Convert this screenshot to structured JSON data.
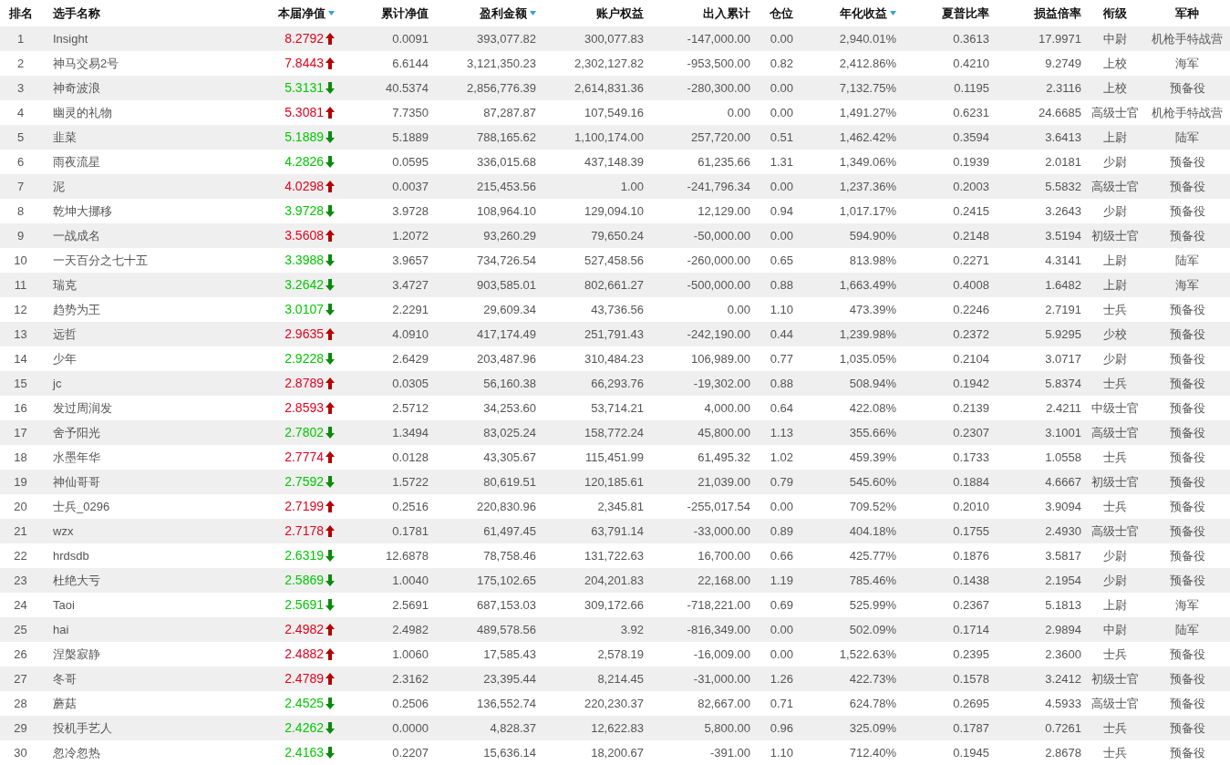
{
  "table": {
    "columns": [
      {
        "label": "排名",
        "sort_indicator": false
      },
      {
        "label": "选手名称",
        "sort_indicator": false
      },
      {
        "label": "本届净值",
        "sort_indicator": true
      },
      {
        "label": "累计净值",
        "sort_indicator": false
      },
      {
        "label": "盈利金额",
        "sort_indicator": true
      },
      {
        "label": "账户权益",
        "sort_indicator": false
      },
      {
        "label": "出入累计",
        "sort_indicator": false
      },
      {
        "label": "仓位",
        "sort_indicator": false
      },
      {
        "label": "年化收益",
        "sort_indicator": true
      },
      {
        "label": "夏普比率",
        "sort_indicator": false
      },
      {
        "label": "损益倍率",
        "sort_indicator": false
      },
      {
        "label": "衔级",
        "sort_indicator": false
      },
      {
        "label": "军种",
        "sort_indicator": false
      }
    ],
    "rows": [
      {
        "rising": true,
        "cells": [
          "1",
          "Insight",
          "8.2792",
          "0.0091",
          "393,077.82",
          "300,077.83",
          "-147,000.00",
          "0.00",
          "2,940.01%",
          "0.3613",
          "17.9971",
          "中尉",
          "机枪手特战营"
        ]
      },
      {
        "rising": true,
        "cells": [
          "2",
          "神马交易2号",
          "7.8443",
          "6.6144",
          "3,121,350.23",
          "2,302,127.82",
          "-953,500.00",
          "0.82",
          "2,412.86%",
          "0.4210",
          "9.2749",
          "上校",
          "海军"
        ]
      },
      {
        "rising": false,
        "cells": [
          "3",
          "神奇波浪",
          "5.3131",
          "40.5374",
          "2,856,776.39",
          "2,614,831.36",
          "-280,300.00",
          "0.00",
          "7,132.75%",
          "0.1195",
          "2.3116",
          "上校",
          "预备役"
        ]
      },
      {
        "rising": true,
        "cells": [
          "4",
          "幽灵的礼物",
          "5.3081",
          "7.7350",
          "87,287.87",
          "107,549.16",
          "0.00",
          "0.00",
          "1,491.27%",
          "0.6231",
          "24.6685",
          "高级士官",
          "机枪手特战营"
        ]
      },
      {
        "rising": false,
        "cells": [
          "5",
          "韭菜",
          "5.1889",
          "5.1889",
          "788,165.62",
          "1,100,174.00",
          "257,720.00",
          "0.51",
          "1,462.42%",
          "0.3594",
          "3.6413",
          "上尉",
          "陆军"
        ]
      },
      {
        "rising": false,
        "cells": [
          "6",
          "雨夜流星",
          "4.2826",
          "0.0595",
          "336,015.68",
          "437,148.39",
          "61,235.66",
          "1.31",
          "1,349.06%",
          "0.1939",
          "2.0181",
          "少尉",
          "预备役"
        ]
      },
      {
        "rising": true,
        "cells": [
          "7",
          "泥",
          "4.0298",
          "0.0037",
          "215,453.56",
          "1.00",
          "-241,796.34",
          "0.00",
          "1,237.36%",
          "0.2003",
          "5.5832",
          "高级士官",
          "预备役"
        ]
      },
      {
        "rising": false,
        "cells": [
          "8",
          "乾坤大挪移",
          "3.9728",
          "3.9728",
          "108,964.10",
          "129,094.10",
          "12,129.00",
          "0.94",
          "1,017.17%",
          "0.2415",
          "3.2643",
          "少尉",
          "预备役"
        ]
      },
      {
        "rising": true,
        "cells": [
          "9",
          "一战成名",
          "3.5608",
          "1.2072",
          "93,260.29",
          "79,650.24",
          "-50,000.00",
          "0.00",
          "594.90%",
          "0.2148",
          "3.5194",
          "初级士官",
          "预备役"
        ]
      },
      {
        "rising": false,
        "cells": [
          "10",
          "一天百分之七十五",
          "3.3988",
          "3.9657",
          "734,726.54",
          "527,458.56",
          "-260,000.00",
          "0.65",
          "813.98%",
          "0.2271",
          "4.3141",
          "上尉",
          "陆军"
        ]
      },
      {
        "rising": false,
        "cells": [
          "11",
          "瑞克",
          "3.2642",
          "3.4727",
          "903,585.01",
          "802,661.27",
          "-500,000.00",
          "0.88",
          "1,663.49%",
          "0.4008",
          "1.6482",
          "上尉",
          "海军"
        ]
      },
      {
        "rising": false,
        "cells": [
          "12",
          "趋势为王",
          "3.0107",
          "2.2291",
          "29,609.34",
          "43,736.56",
          "0.00",
          "1.10",
          "473.39%",
          "0.2246",
          "2.7191",
          "士兵",
          "预备役"
        ]
      },
      {
        "rising": true,
        "cells": [
          "13",
          "远哲",
          "2.9635",
          "4.0910",
          "417,174.49",
          "251,791.43",
          "-242,190.00",
          "0.44",
          "1,239.98%",
          "0.2372",
          "5.9295",
          "少校",
          "预备役"
        ]
      },
      {
        "rising": false,
        "cells": [
          "14",
          "少年",
          "2.9228",
          "2.6429",
          "203,487.96",
          "310,484.23",
          "106,989.00",
          "0.77",
          "1,035.05%",
          "0.2104",
          "3.0717",
          "少尉",
          "预备役"
        ]
      },
      {
        "rising": true,
        "cells": [
          "15",
          "jc",
          "2.8789",
          "0.0305",
          "56,160.38",
          "66,293.76",
          "-19,302.00",
          "0.88",
          "508.94%",
          "0.1942",
          "5.8374",
          "士兵",
          "预备役"
        ]
      },
      {
        "rising": true,
        "cells": [
          "16",
          "发过周润发",
          "2.8593",
          "2.5712",
          "34,253.60",
          "53,714.21",
          "4,000.00",
          "0.64",
          "422.08%",
          "0.2139",
          "2.4211",
          "中级士官",
          "预备役"
        ]
      },
      {
        "rising": false,
        "cells": [
          "17",
          "舍予阳光",
          "2.7802",
          "1.3494",
          "83,025.24",
          "158,772.24",
          "45,800.00",
          "1.13",
          "355.66%",
          "0.2307",
          "3.1001",
          "高级士官",
          "预备役"
        ]
      },
      {
        "rising": true,
        "cells": [
          "18",
          "水墨年华",
          "2.7774",
          "0.0128",
          "43,305.67",
          "115,451.99",
          "61,495.32",
          "1.02",
          "459.39%",
          "0.1733",
          "1.0558",
          "士兵",
          "预备役"
        ]
      },
      {
        "rising": false,
        "cells": [
          "19",
          "神仙哥哥",
          "2.7592",
          "1.5722",
          "80,619.51",
          "120,185.61",
          "21,039.00",
          "0.79",
          "545.60%",
          "0.1884",
          "4.6667",
          "初级士官",
          "预备役"
        ]
      },
      {
        "rising": true,
        "cells": [
          "20",
          "士兵_0296",
          "2.7199",
          "0.2516",
          "220,830.96",
          "2,345.81",
          "-255,017.54",
          "0.00",
          "709.52%",
          "0.2010",
          "3.9094",
          "士兵",
          "预备役"
        ]
      },
      {
        "rising": true,
        "cells": [
          "21",
          "wzx",
          "2.7178",
          "0.1781",
          "61,497.45",
          "63,791.14",
          "-33,000.00",
          "0.89",
          "404.18%",
          "0.1755",
          "2.4930",
          "高级士官",
          "预备役"
        ]
      },
      {
        "rising": false,
        "cells": [
          "22",
          "hrdsdb",
          "2.6319",
          "12.6878",
          "78,758.46",
          "131,722.63",
          "16,700.00",
          "0.66",
          "425.77%",
          "0.1876",
          "3.5817",
          "少尉",
          "预备役"
        ]
      },
      {
        "rising": false,
        "cells": [
          "23",
          "杜绝大亏",
          "2.5869",
          "1.0040",
          "175,102.65",
          "204,201.83",
          "22,168.00",
          "1.19",
          "785.46%",
          "0.1438",
          "2.1954",
          "少尉",
          "预备役"
        ]
      },
      {
        "rising": false,
        "cells": [
          "24",
          "Taoi",
          "2.5691",
          "2.5691",
          "687,153.03",
          "309,172.66",
          "-718,221.00",
          "0.69",
          "525.99%",
          "0.2367",
          "5.1813",
          "上尉",
          "海军"
        ]
      },
      {
        "rising": true,
        "cells": [
          "25",
          "hai",
          "2.4982",
          "2.4982",
          "489,578.56",
          "3.92",
          "-816,349.00",
          "0.00",
          "502.09%",
          "0.1714",
          "2.9894",
          "中尉",
          "陆军"
        ]
      },
      {
        "rising": true,
        "cells": [
          "26",
          "涅槃寂静",
          "2.4882",
          "1.0060",
          "17,585.43",
          "2,578.19",
          "-16,009.00",
          "0.00",
          "1,522.63%",
          "0.2395",
          "2.3600",
          "士兵",
          "预备役"
        ]
      },
      {
        "rising": true,
        "cells": [
          "27",
          "冬哥",
          "2.4789",
          "2.3162",
          "23,395.44",
          "8,214.45",
          "-31,000.00",
          "1.26",
          "422.73%",
          "0.1578",
          "3.2412",
          "初级士官",
          "预备役"
        ]
      },
      {
        "rising": false,
        "cells": [
          "28",
          "蘑菇",
          "2.4525",
          "0.2506",
          "136,552.74",
          "220,230.37",
          "82,667.00",
          "0.71",
          "624.78%",
          "0.2695",
          "4.5933",
          "高级士官",
          "预备役"
        ]
      },
      {
        "rising": false,
        "cells": [
          "29",
          "投机手艺人",
          "2.4262",
          "0.0000",
          "4,828.37",
          "12,622.83",
          "5,800.00",
          "0.96",
          "325.09%",
          "0.1787",
          "0.7261",
          "士兵",
          "预备役"
        ]
      },
      {
        "rising": false,
        "cells": [
          "30",
          "忽冷忽热",
          "2.4163",
          "0.2207",
          "15,636.14",
          "18,200.67",
          "-391.00",
          "1.10",
          "712.40%",
          "0.1945",
          "2.8678",
          "士兵",
          "预备役"
        ]
      }
    ]
  }
}
